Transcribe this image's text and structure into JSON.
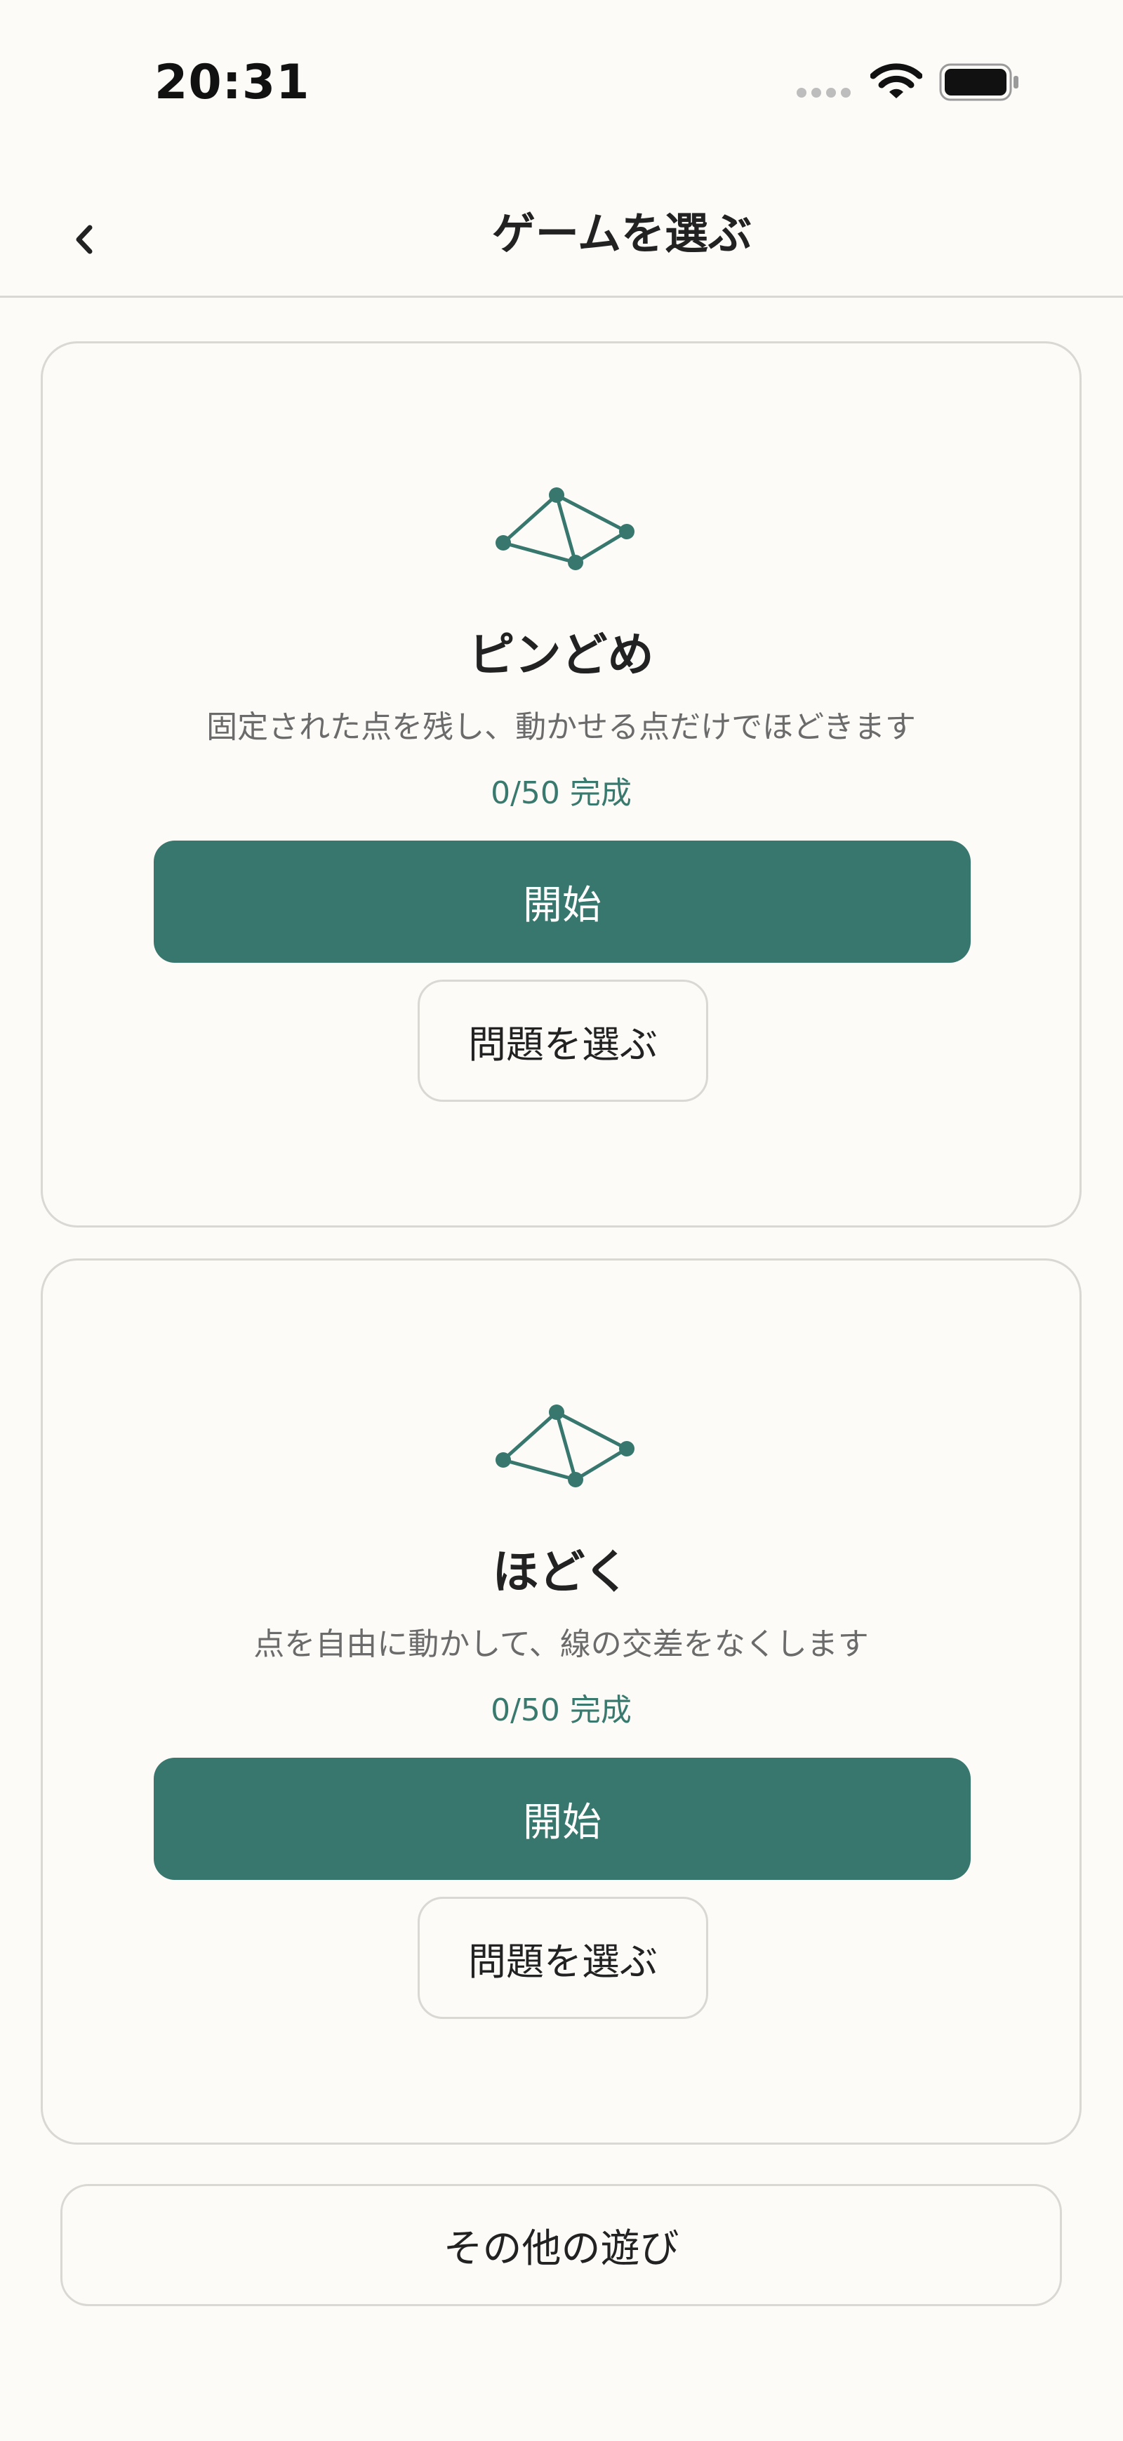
{
  "status_bar": {
    "time": "20:31",
    "icons": [
      "signal-dots-icon",
      "wifi-icon",
      "battery-icon"
    ]
  },
  "header": {
    "title": "ゲームを選ぶ",
    "back_icon": "chevron-left-icon"
  },
  "games": [
    {
      "icon": "network-graph-icon",
      "title": "ピンどめ",
      "description": "固定された点を残し、動かせる点だけでほどきます",
      "progress": "0/50 完成",
      "start_label": "開始",
      "select_label": "問題を選ぶ"
    },
    {
      "icon": "network-graph-icon",
      "title": "ほどく",
      "description": "点を自由に動かして、線の交差をなくします",
      "progress": "0/50 完成",
      "start_label": "開始",
      "select_label": "問題を選ぶ"
    }
  ],
  "other_label": "その他の遊び",
  "colors": {
    "accent": "#38776d",
    "background": "#fcfbf8",
    "border": "#d9d8d3",
    "progress_text": "#3a7a6e"
  }
}
